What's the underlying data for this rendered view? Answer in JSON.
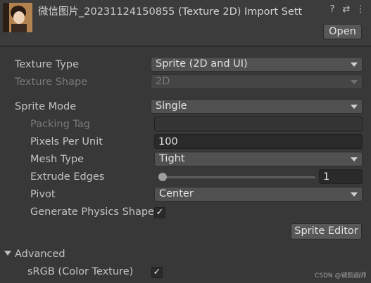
{
  "header": {
    "title": "微信图片_20231124150855 (Texture 2D) Import Sett",
    "help_glyph": "?",
    "preset_glyph": "⇄",
    "menu_glyph": "⋮",
    "open_label": "Open"
  },
  "texture_type": {
    "label": "Texture Type",
    "value": "Sprite (2D and UI)"
  },
  "texture_shape": {
    "label": "Texture Shape",
    "value": "2D"
  },
  "sprite_mode": {
    "label": "Sprite Mode",
    "value": "Single"
  },
  "packing_tag": {
    "label": "Packing Tag",
    "value": ""
  },
  "pixels_per_unit": {
    "label": "Pixels Per Unit",
    "value": "100"
  },
  "mesh_type": {
    "label": "Mesh Type",
    "value": "Tight"
  },
  "extrude_edges": {
    "label": "Extrude Edges",
    "value": "1",
    "slider_fraction": 0.03
  },
  "pivot": {
    "label": "Pivot",
    "value": "Center"
  },
  "generate_physics": {
    "label": "Generate Physics Shape",
    "checked": true,
    "check_glyph": "✓"
  },
  "sprite_editor_label": "Sprite Editor",
  "advanced": {
    "label": "Advanced",
    "expanded": true
  },
  "srgb": {
    "label": "sRGB (Color Texture)",
    "checked": true,
    "check_glyph": "✓"
  },
  "watermark": "CSDN @键韵画师",
  "colors": {
    "background": "#383838",
    "field": "#2a2a2a",
    "dropdown": "#515151",
    "button": "#585858"
  }
}
